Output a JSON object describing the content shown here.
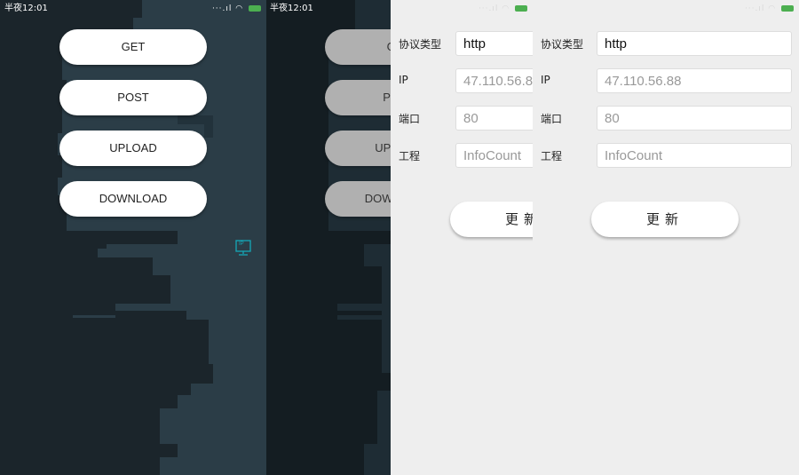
{
  "status_bar": {
    "time": "半夜12:01",
    "signal_icons": "... .ıl"
  },
  "menu": {
    "buttons": [
      {
        "label": "GET"
      },
      {
        "label": "POST"
      },
      {
        "label": "UPLOAD"
      },
      {
        "label": "DOWNLOAD"
      }
    ],
    "ip_badge": "IP"
  },
  "settings": {
    "protocol": {
      "label": "协议类型",
      "value": "http"
    },
    "ip": {
      "label": "IP",
      "placeholder": "47.110.56.88"
    },
    "port": {
      "label": "端口",
      "placeholder": "80"
    },
    "project": {
      "label": "工程",
      "placeholder": "InfoCount"
    },
    "update_label": "更新"
  },
  "colors": {
    "dark_bg": "#1b252b",
    "city": "#2b3d47",
    "accent": "#14a8b8",
    "light_bg": "#eeeeee"
  }
}
